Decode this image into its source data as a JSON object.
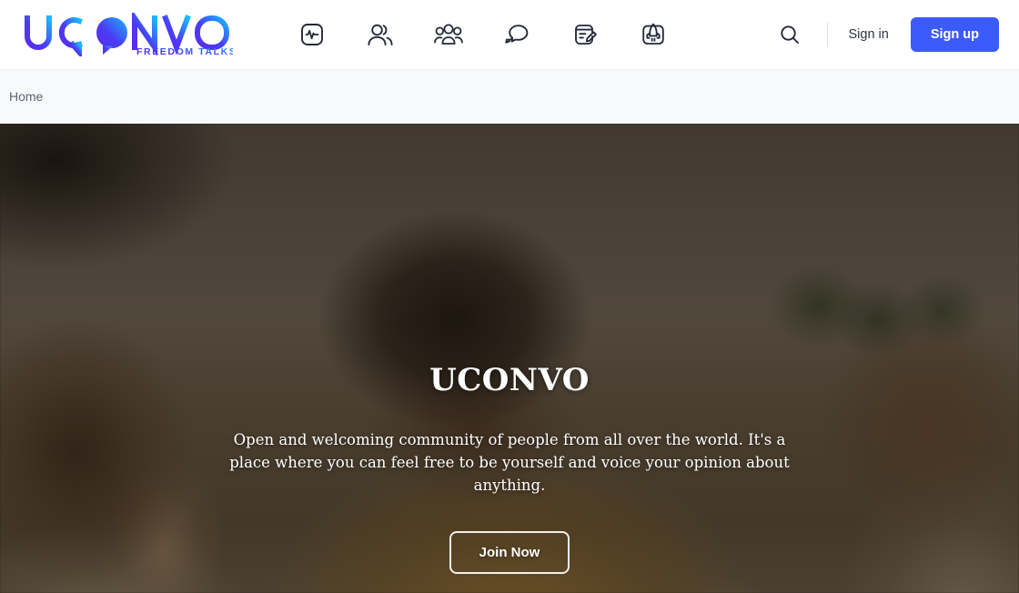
{
  "header": {
    "logo": {
      "text": "UCONVO",
      "tagline": "FREEDOM TALKS",
      "gradient_start": "#5b2bf0",
      "gradient_end": "#19b9ff"
    },
    "nav_icons": [
      {
        "name": "activity-icon",
        "label": "Activity"
      },
      {
        "name": "users-icon",
        "label": "Users"
      },
      {
        "name": "groups-icon",
        "label": "Groups"
      },
      {
        "name": "forums-icon",
        "label": "Forums"
      },
      {
        "name": "blog-icon",
        "label": "Blog"
      },
      {
        "name": "launch-icon",
        "label": "Launch"
      }
    ],
    "search_label": "Search",
    "sign_in_label": "Sign in",
    "sign_up_label": "Sign up",
    "sign_up_color": "#3b5bfd"
  },
  "breadcrumb": {
    "items": [
      {
        "label": "Home"
      }
    ]
  },
  "hero": {
    "title": "UCONVO",
    "subtitle": "Open and welcoming community of people from all over the world. It's a place where you can feel free to be yourself and voice your opinion about anything.",
    "cta_label": "Join Now",
    "overlay_color": "rgba(24,18,12,0.50)"
  }
}
